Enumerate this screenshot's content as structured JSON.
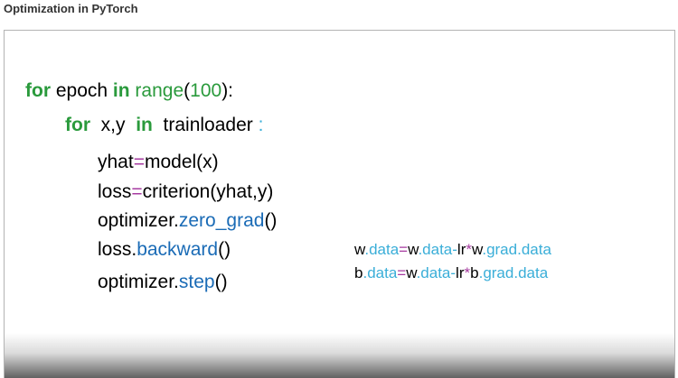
{
  "header": {
    "title": "Optimization in PyTorch"
  },
  "code": {
    "l1": {
      "kw_for": "for",
      "var": "epoch",
      "kw_in": "in",
      "fn": "range",
      "open": "(",
      "num": "100",
      "close": "):"
    },
    "l2": {
      "kw_for": "for",
      "vars": "x,y",
      "kw_in": "in",
      "iter": "trainloader",
      "colon": ":"
    },
    "l3": {
      "lhs": "yhat",
      "eq": "=",
      "rhs": "model(x)"
    },
    "l4": {
      "lhs": "loss",
      "eq": "=",
      "rhs": "criterion(yhat,y)"
    },
    "l5": {
      "obj": "optimizer",
      "dot": ".",
      "method": "zero_grad",
      "paren": "()"
    },
    "l6": {
      "obj": "loss",
      "dot": ".",
      "method": "backward",
      "paren": "()"
    },
    "l7": {
      "obj": "optimizer",
      "dot": ".",
      "method": "step",
      "paren": "()"
    }
  },
  "formulas": {
    "w": {
      "a": "w",
      "b": ".data",
      "c": "=",
      "d": "w",
      "e": ".data",
      "f": "-",
      "g": "lr",
      "h": "*",
      "i": "w",
      "j": ".grad",
      "k": ".data"
    },
    "b": {
      "a": "b",
      "b": ".data",
      "c": "=",
      "d": "w",
      "e": ".data",
      "f": "-",
      "g": "lr",
      "h": "*",
      "i": "b",
      "j": ".grad",
      "k": ".data"
    }
  },
  "colors": {
    "keyword": "#2a9a3c",
    "operator": "#a63aa0",
    "method": "#1a6bb6",
    "attribute": "#3aaed8",
    "text": "#000000"
  }
}
